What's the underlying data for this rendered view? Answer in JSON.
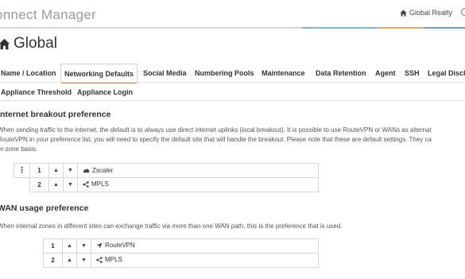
{
  "header": {
    "app_title": "onnect Manager",
    "org_name": "Global Realty"
  },
  "page": {
    "title": "Global"
  },
  "tabs": [
    {
      "label": "Name / Location"
    },
    {
      "label": "Networking Defaults",
      "active": true
    },
    {
      "label": "Social Media"
    },
    {
      "label": "Numbering Pools"
    },
    {
      "label": "Maintenance"
    },
    {
      "label": "Data Retention"
    },
    {
      "label": "Agent"
    },
    {
      "label": "SSH"
    },
    {
      "label": "Legal Discla"
    },
    {
      "label": "Appliance Threshold"
    },
    {
      "label": "Appliance Login"
    }
  ],
  "breakout": {
    "title": "nternet breakout preference",
    "desc_line1": "When sending traffic to the internet, the default is to always use direct internet uplinks (local breakout). It is possible to use RouteVPN or WANs as alternat",
    "desc_line2": "RouteVPN in your preference list, you will need to specify the default site that will handle the breakout. Please note that these are default settings. They ca",
    "desc_line3": "er-zone basis.",
    "rows": [
      {
        "num": "1",
        "name": "Zscaler",
        "icon": "cloud-icon"
      },
      {
        "num": "2",
        "name": "MPLS",
        "icon": "share-icon"
      }
    ]
  },
  "wan": {
    "title": "WAN usage preference",
    "desc": "When internal zones in different sites can exchange traffic via more than one WAN path, this is the preference that is used.",
    "rows": [
      {
        "num": "1",
        "name": "RouteVPN",
        "icon": "location-arrow-icon"
      },
      {
        "num": "2",
        "name": "MPLS",
        "icon": "share-icon"
      }
    ]
  },
  "icons": {
    "up": "▲",
    "down": "▼",
    "menu": "⋮"
  },
  "colors": {
    "accent": "#f07d2c",
    "stripe_blue": "#7fb6d6",
    "stripe_orange": "#f0a560"
  }
}
